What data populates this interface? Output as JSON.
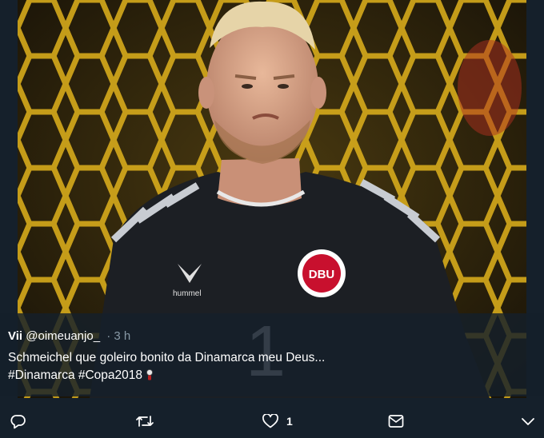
{
  "tweet": {
    "display_name": "Vii",
    "handle": "@oimeuanjo_",
    "separator": "·",
    "time": "3 h",
    "text": "Schmeichel que goleiro bonito da Dinamarca meu Deus...",
    "hashtags": "#Dinamarca #Copa2018"
  },
  "photo": {
    "jersey_brand": "hummel",
    "crest_text": "DBU",
    "shirt_number": "1"
  },
  "actions": {
    "reply_icon": "reply-icon",
    "retweet_icon": "retweet-icon",
    "like_icon": "heart-icon",
    "like_count": "1",
    "dm_icon": "envelope-icon",
    "more_icon": "chevron-down-icon"
  },
  "colors": {
    "background": "#15202b",
    "text": "#ffffff",
    "muted": "#8899a6",
    "net": "#d4a21a"
  }
}
